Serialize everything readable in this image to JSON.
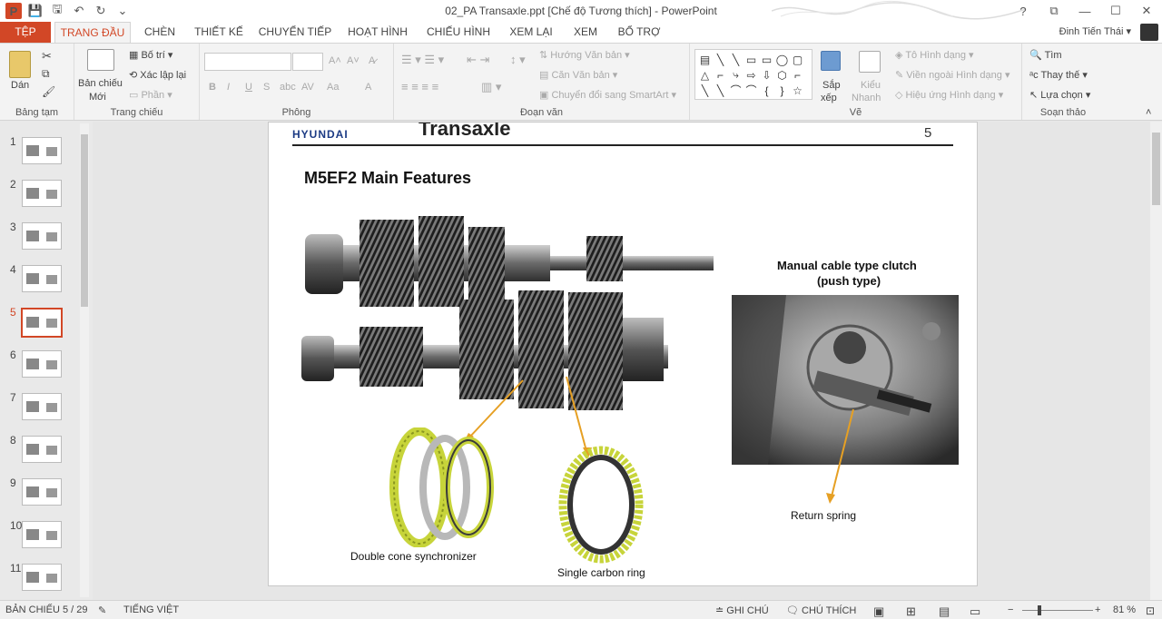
{
  "window": {
    "title": "02_PA Transaxle.ppt [Chế độ Tương thích] - PowerPoint"
  },
  "qat": {
    "logo": "P",
    "save": "💾",
    "save2": "🖫",
    "undo": "↶",
    "redo": "↻",
    "more": "⌄"
  },
  "controls": {
    "help": "?",
    "ribbon_opts": "⧉",
    "minimize": "—",
    "maximize": "☐",
    "close": "✕"
  },
  "tabs": [
    "TỆP",
    "TRANG ĐẦU",
    "CHÈN",
    "THIẾT KẾ",
    "CHUYỂN TIẾP",
    "HOẠT HÌNH",
    "CHIẾU HÌNH",
    "XEM LẠI",
    "XEM",
    "BỔ TRỢ"
  ],
  "user": {
    "name": "Đinh Tiến Thái",
    "caret": "▾"
  },
  "ribbon": {
    "clipboard": {
      "label": "Bảng tạm",
      "paste": "Dán"
    },
    "slides": {
      "label": "Trang chiếu",
      "new_slide_1": "Bản chiếu",
      "new_slide_2": "Mới",
      "layout": "Bố trí",
      "reset": "Xác lập lại",
      "section": "Phần"
    },
    "font": {
      "label": "Phông",
      "bold": "B",
      "italic": "I",
      "underline": "U",
      "strike": "S",
      "shadow": "abc",
      "spacing": "AV",
      "case": "Aa",
      "color": "A",
      "grow": "A˄",
      "shrink": "A˅",
      "clear": "A̷"
    },
    "paragraph": {
      "label": "Đoạn văn",
      "text_dir": "Hướng Văn bản",
      "align_text": "Căn Văn bản",
      "smartart": "Chuyển đổi sang SmartArt"
    },
    "drawing": {
      "label": "Vẽ",
      "arrange_1": "Sắp",
      "arrange_2": "xếp",
      "styles_1": "Kiểu",
      "styles_2": "Nhanh",
      "fill": "Tô Hình dạng",
      "outline": "Viền ngoài Hình dạng",
      "effects": "Hiệu ứng Hình dạng"
    },
    "editing": {
      "label": "Soạn thảo",
      "find": "Tìm",
      "replace": "Thay thế",
      "select": "Lựa chọn"
    }
  },
  "shapes_gallery": [
    "▤",
    "╲",
    "╲",
    "▭",
    "▭",
    "◯",
    "▢",
    "△",
    "⌐",
    "⤷",
    "⇨",
    "⇩",
    "⬡",
    "⌐",
    "╲",
    "╲",
    "⌒",
    "⌒",
    "{",
    "}",
    "☆"
  ],
  "thumbnails": [
    "1",
    "2",
    "3",
    "4",
    "5",
    "6",
    "7",
    "8",
    "9",
    "10",
    "11"
  ],
  "slide": {
    "logo": "HYUNDAI",
    "title": "Transaxle",
    "number": "5",
    "heading": "M5EF2 Main Features",
    "photo_caption_1": "Manual cable type clutch",
    "photo_caption_2": "(push type)",
    "label_return_spring": "Return spring",
    "label_double_cone": "Double cone synchronizer",
    "label_single_carbon": "Single carbon ring"
  },
  "status": {
    "slide_info": "BẢN CHIẾU 5 / 29",
    "language": "TIẾNG VIỆT",
    "notes": "GHI CHÚ",
    "comments": "CHÚ THÍCH",
    "zoom_out": "−",
    "zoom_in": "+",
    "zoom": "81 %",
    "zoom_level": 0.81
  },
  "colors": {
    "accent": "#d24726",
    "gear_yellow": "#c7d43a",
    "arrow": "#e6a024"
  }
}
